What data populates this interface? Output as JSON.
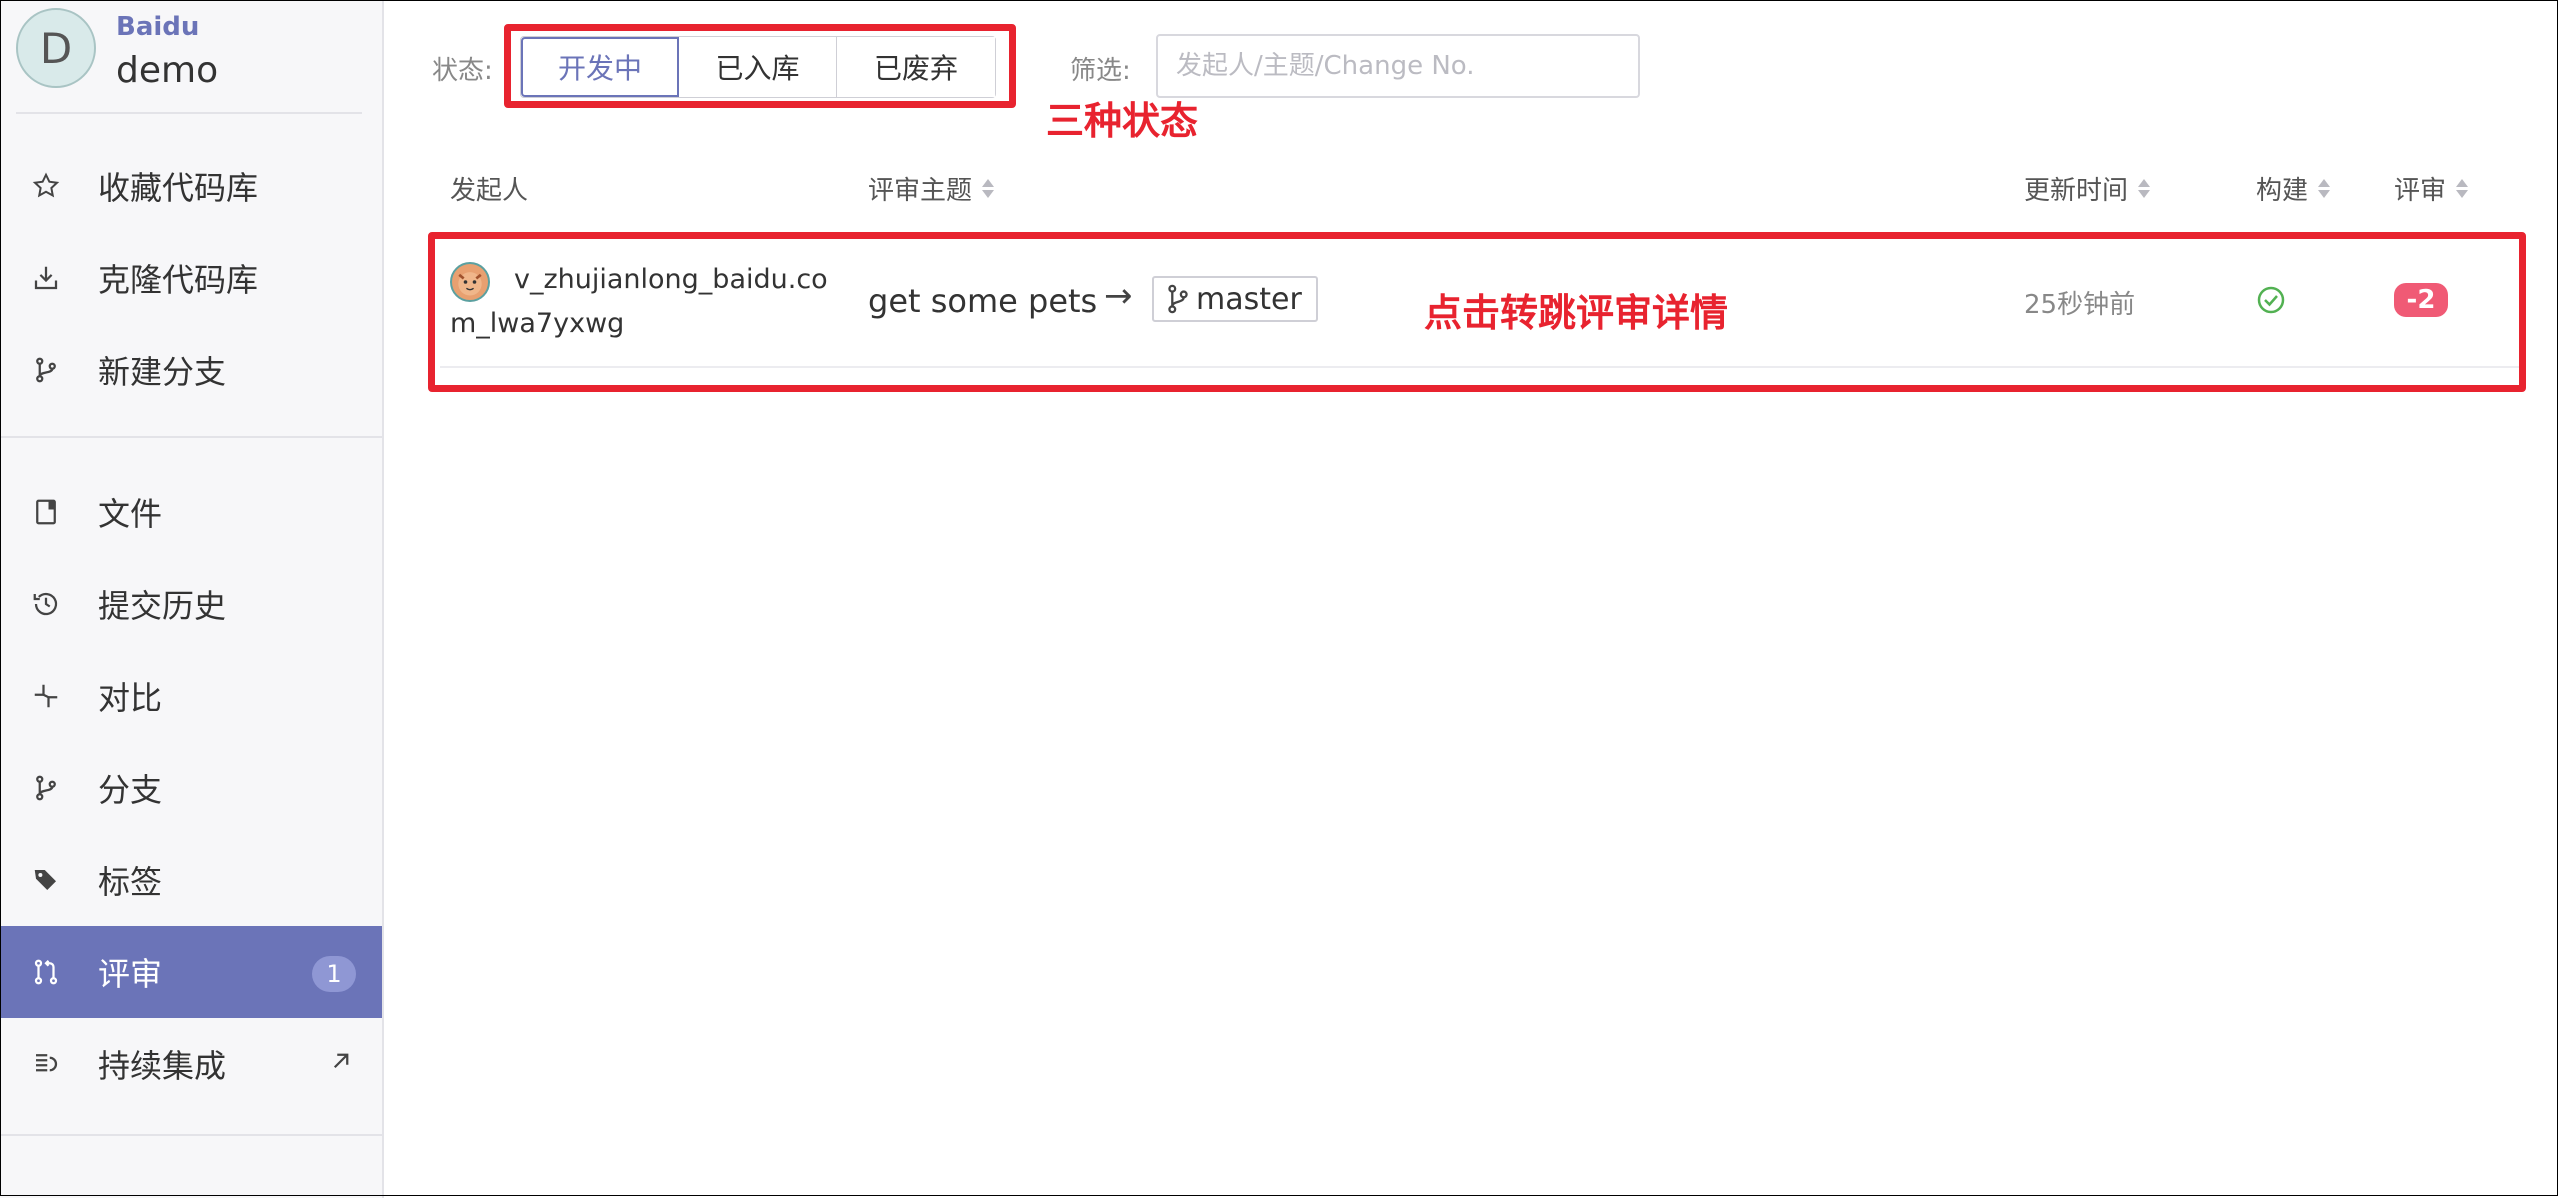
{
  "sidebar": {
    "avatar_letter": "D",
    "org": "Baidu",
    "repo": "demo",
    "items": [
      {
        "label": "收藏代码库",
        "icon": "star-icon"
      },
      {
        "label": "克隆代码库",
        "icon": "download-icon"
      },
      {
        "label": "新建分支",
        "icon": "branch-icon"
      },
      {
        "label": "文件",
        "icon": "file-icon"
      },
      {
        "label": "提交历史",
        "icon": "history-icon"
      },
      {
        "label": "对比",
        "icon": "compare-icon"
      },
      {
        "label": "分支",
        "icon": "branch-icon"
      },
      {
        "label": "标签",
        "icon": "tag-icon"
      },
      {
        "label": "评审",
        "icon": "pull-request-icon",
        "badge": "1",
        "active": true
      },
      {
        "label": "持续集成",
        "icon": "ci-icon"
      }
    ]
  },
  "filters": {
    "status_label": "状态:",
    "status_options": [
      "开发中",
      "已入库",
      "已废弃"
    ],
    "selected_status": "开发中",
    "filter_label": "筛选:",
    "search_placeholder": "发起人/主题/Change No."
  },
  "table": {
    "headers": [
      "发起人",
      "评审主题",
      "更新时间",
      "构建",
      "评审"
    ],
    "rows": [
      {
        "author": "v_zhujianlong_baidu.com_lwa7yxwg",
        "subject": "get some pets",
        "arrow": "→",
        "target_branch": "master",
        "updated": "25秒钟前",
        "build_status": "success",
        "review_score": "-2"
      }
    ]
  },
  "annotations": {
    "status_note": "三种状态",
    "row_note": "点击转跳评审详情",
    "color": "#e8232f"
  },
  "colors": {
    "accent": "#6b74b8",
    "badge": "#8f97d4",
    "review_negative": "#f05a75",
    "build_ok": "#52b152"
  }
}
